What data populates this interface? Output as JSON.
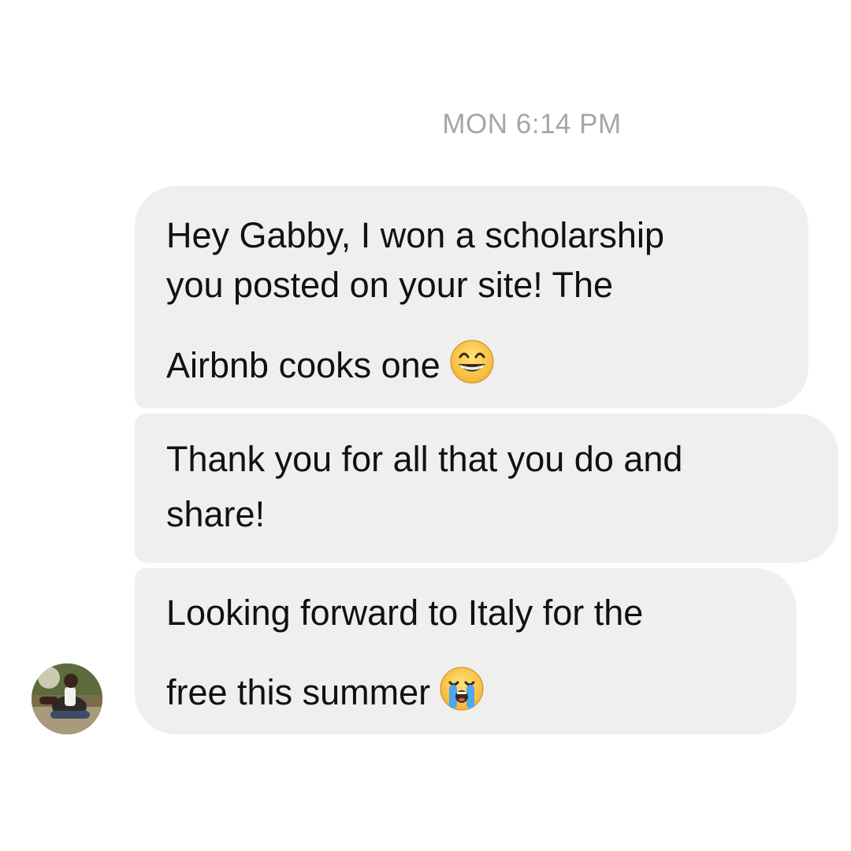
{
  "conversation": {
    "timestamp": "MON 6:14 PM",
    "messages": [
      {
        "lines": [
          "Hey Gabby, I won a scholarship",
          "you posted on your site! The",
          "Airbnb cooks one"
        ],
        "trailing_emoji": "grinning-face-with-smiling-eyes-emoji"
      },
      {
        "lines": [
          "Thank you for all that you do and",
          "share!"
        ]
      },
      {
        "lines": [
          "Looking forward to Italy for the",
          "free this summer"
        ],
        "trailing_emoji": "loudly-crying-face-emoji"
      }
    ]
  },
  "colors": {
    "bubble_background": "#efefef",
    "timestamp_text": "#a6a6a6",
    "message_text": "#111111"
  }
}
